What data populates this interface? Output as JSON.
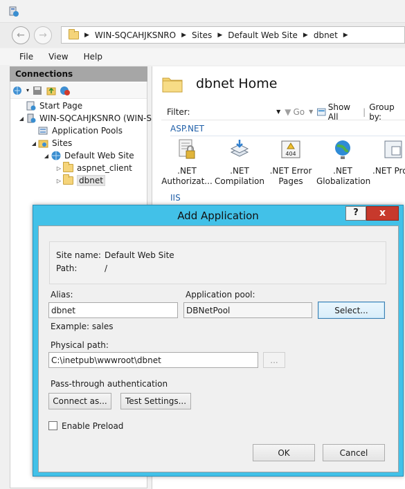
{
  "window": {
    "breadcrumbs": [
      "WIN-SQCAHJKSNRO",
      "Sites",
      "Default Web Site",
      "dbnet"
    ],
    "menu": [
      "File",
      "View",
      "Help"
    ]
  },
  "connections": {
    "header": "Connections",
    "tree": [
      {
        "label": "Start Page",
        "level": 0
      },
      {
        "label": "WIN-SQCAHJKSNRO (WIN-SQ",
        "level": 0
      },
      {
        "label": "Application Pools",
        "level": 1
      },
      {
        "label": "Sites",
        "level": 1
      },
      {
        "label": "Default Web Site",
        "level": 2
      },
      {
        "label": "aspnet_client",
        "level": 3
      },
      {
        "label": "dbnet",
        "level": 3
      }
    ]
  },
  "home": {
    "title": "dbnet Home",
    "filter_label": "Filter:",
    "go_label": "Go",
    "show_all_label": "Show All",
    "group_by_label": "Group by:",
    "section_aspnet": "ASP.NET",
    "section_iis": "IIS",
    "features": [
      {
        "line1": ".NET",
        "line2": "Authorizat..."
      },
      {
        "line1": ".NET",
        "line2": "Compilation"
      },
      {
        "line1": ".NET Error",
        "line2": "Pages"
      },
      {
        "line1": ".NET",
        "line2": "Globalization"
      },
      {
        "line1": ".NET Pro",
        "line2": ""
      }
    ]
  },
  "dialog": {
    "title": "Add Application",
    "help_label": "?",
    "close_label": "x",
    "site_name_label": "Site name:",
    "site_name_value": "Default Web Site",
    "path_label": "Path:",
    "path_value": "/",
    "alias_label": "Alias:",
    "alias_value": "dbnet",
    "alias_example": "Example: sales",
    "app_pool_label": "Application pool:",
    "app_pool_value": "DBNetPool",
    "select_button": "Select...",
    "physical_path_label": "Physical path:",
    "physical_path_value": "C:\\inetpub\\wwwroot\\dbnet",
    "browse_button": "...",
    "passthrough_label": "Pass-through authentication",
    "connect_as_button": "Connect as...",
    "test_settings_button": "Test Settings...",
    "enable_preload_label": "Enable Preload",
    "enable_preload_checked": false,
    "ok_button": "OK",
    "cancel_button": "Cancel"
  }
}
